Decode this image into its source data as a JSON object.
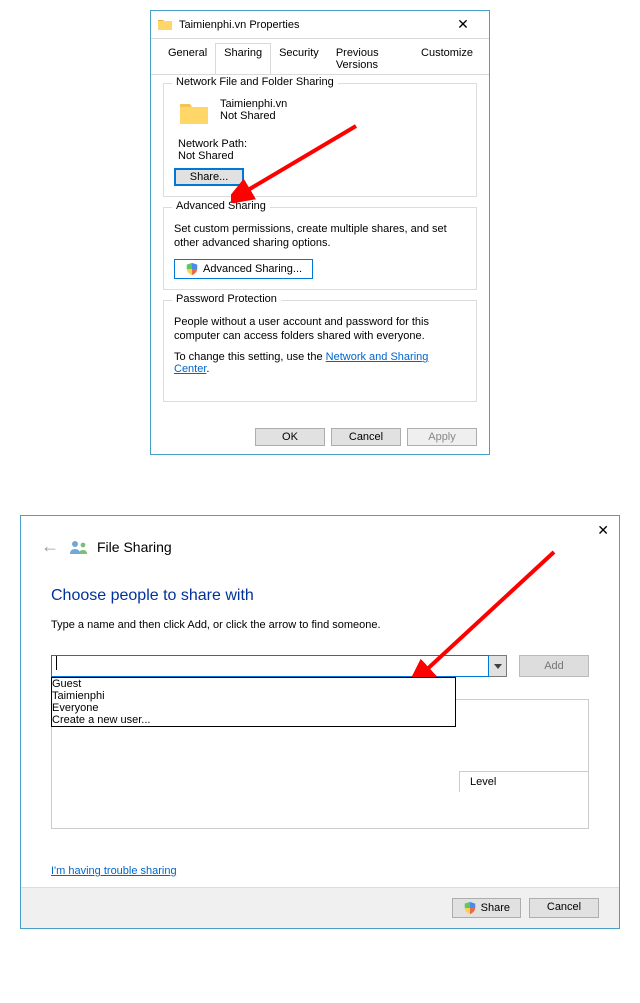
{
  "dialog1": {
    "title": "Taimienphi.vn Properties",
    "tabs": {
      "general": "General",
      "sharing": "Sharing",
      "security": "Security",
      "previous": "Previous Versions",
      "customize": "Customize"
    },
    "network_group": {
      "title": "Network File and Folder Sharing",
      "folder_name": "Taimienphi.vn",
      "share_status": "Not Shared",
      "path_label": "Network Path:",
      "path_value": "Not Shared",
      "share_button": "Share..."
    },
    "advanced_group": {
      "title": "Advanced Sharing",
      "text": "Set custom permissions, create multiple shares, and set other advanced sharing options.",
      "button": "Advanced Sharing..."
    },
    "password_group": {
      "title": "Password Protection",
      "text1": "People without a user account and password for this computer can access folders shared with everyone.",
      "text2_prefix": "To change this setting, use the ",
      "link": "Network and Sharing Center",
      "text2_suffix": "."
    },
    "footer": {
      "ok": "OK",
      "cancel": "Cancel",
      "apply": "Apply"
    }
  },
  "dialog2": {
    "title": "File Sharing",
    "heading": "Choose people to share with",
    "instruction": "Type a name and then click Add, or click the arrow to find someone.",
    "add_button": "Add",
    "perm_level_header": "Level",
    "dropdown_items": {
      "guest": "Guest",
      "taimienphi": "Taimienphi",
      "everyone": "Everyone",
      "create": "Create a new user..."
    },
    "trouble_link": "I'm having trouble sharing",
    "footer": {
      "share": "Share",
      "cancel": "Cancel"
    }
  }
}
